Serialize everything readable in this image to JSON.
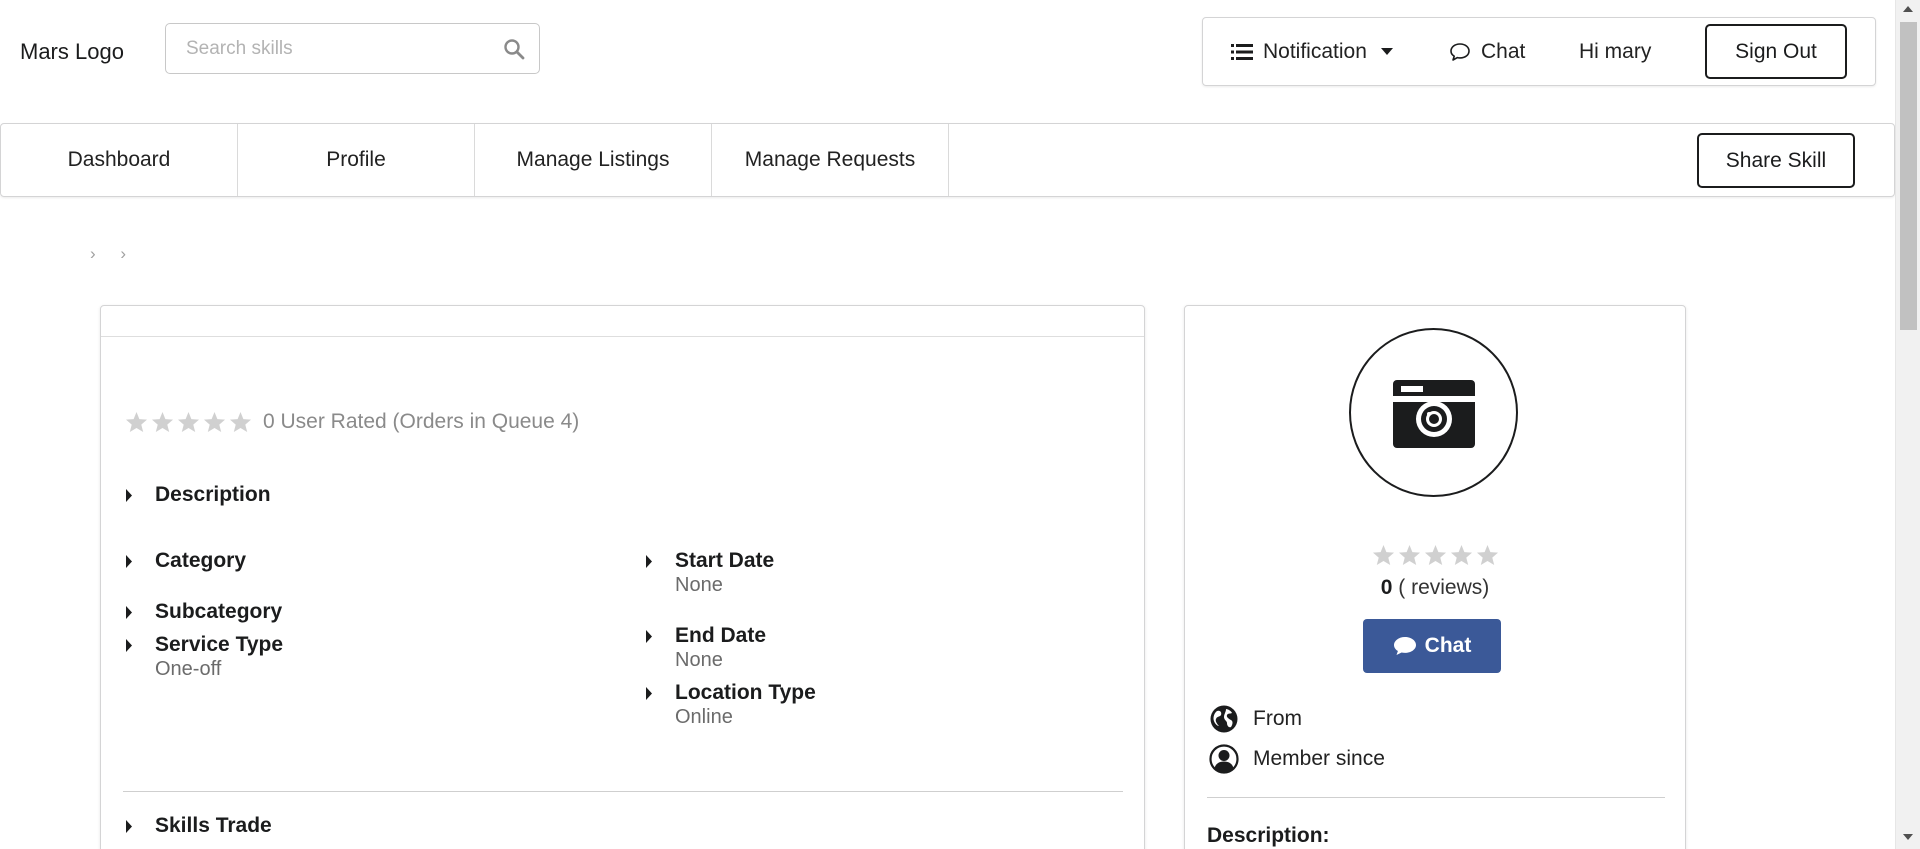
{
  "header": {
    "logo": "Mars Logo",
    "search_placeholder": "Search skills",
    "notification_label": "Notification",
    "chat_label": "Chat",
    "greeting": "Hi mary",
    "signout_label": "Sign Out"
  },
  "nav": {
    "items": [
      {
        "label": "Dashboard"
      },
      {
        "label": "Profile"
      },
      {
        "label": "Manage Listings"
      },
      {
        "label": "Manage Requests"
      }
    ],
    "share_label": "Share Skill"
  },
  "breadcrumb": {
    "separators": [
      "›",
      "›"
    ]
  },
  "listing": {
    "rating_stars": 0,
    "rating_text": "0 User Rated (Orders in Queue 4)",
    "fields": {
      "description": {
        "label": "Description"
      },
      "category": {
        "label": "Category"
      },
      "subcategory": {
        "label": "Subcategory"
      },
      "service_type": {
        "label": "Service Type",
        "value": "One-off"
      },
      "start_date": {
        "label": "Start Date",
        "value": "None"
      },
      "end_date": {
        "label": "End Date",
        "value": "None"
      },
      "location_type": {
        "label": "Location Type",
        "value": "Online"
      },
      "skills_trade": {
        "label": "Skills Trade"
      }
    }
  },
  "seller": {
    "rating_stars": 0,
    "review_count": "0",
    "reviews_suffix": " ( reviews)",
    "chat_label": "Chat",
    "from_label": "From",
    "member_label": "Member since",
    "description_label": "Description:"
  },
  "colors": {
    "chat_button": "#3b5998",
    "star_empty": "#d0d0d0"
  },
  "icons": [
    "search-icon",
    "list-icon",
    "caret-down-icon",
    "chat-bubble-icon",
    "star-icon",
    "triangle-right-icon",
    "camera-icon",
    "globe-icon",
    "user-icon"
  ]
}
